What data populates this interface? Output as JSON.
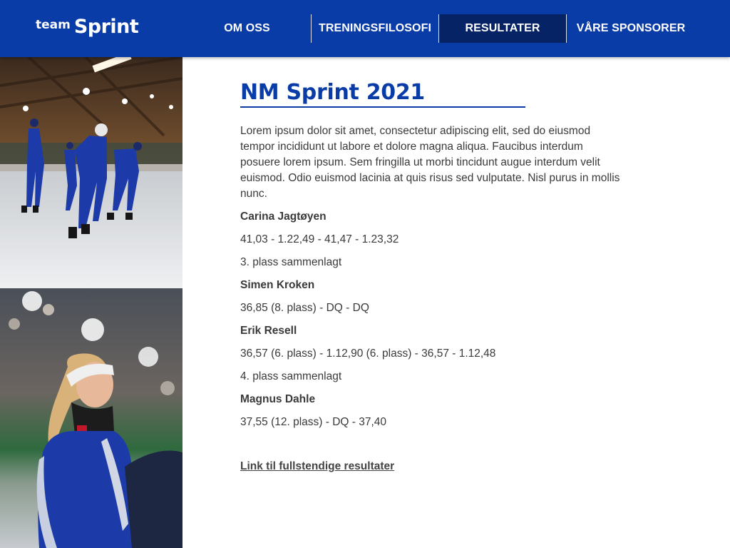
{
  "header": {
    "logo_small": "team",
    "logo_big": "Sprint",
    "nav": [
      {
        "label": "OM OSS"
      },
      {
        "label": "TRENINGSFILOSOFI"
      },
      {
        "label": "RESULTATER"
      },
      {
        "label": "VÅRE SPONSORER"
      }
    ],
    "active_nav": "RESULTATER"
  },
  "colors": {
    "brand_blue": "#0a3ca8",
    "active_nav_bg": "#062366"
  },
  "photos": [
    {
      "icon": "speed-skaters-photo"
    },
    {
      "icon": "skater-portrait-photo"
    }
  ],
  "main": {
    "title": "NM Sprint 2021",
    "intro": "Lorem ipsum dolor sit amet, consectetur adipiscing elit, sed do eiusmod tempor incididunt ut labore et dolore magna aliqua. Faucibus interdum posuere lorem ipsum. Sem fringilla ut morbi tincidunt augue interdum velit euismod. Odio euismod lacinia at quis risus sed vulputate. Nisl purus in mollis nunc.",
    "results": [
      {
        "kind": "name",
        "text": "Carina Jagtøyen"
      },
      {
        "kind": "line",
        "text": "41,03 - 1.22,49 - 41,47 - 1.23,32"
      },
      {
        "kind": "line",
        "text": "3. plass sammenlagt"
      },
      {
        "kind": "name",
        "text": "Simen Kroken"
      },
      {
        "kind": "line",
        "text": "36,85 (8. plass) - DQ - DQ"
      },
      {
        "kind": "name",
        "text": "Erik Resell"
      },
      {
        "kind": "line",
        "text": "36,57 (6. plass) - 1.12,90 (6. plass) - 36,57 - 1.12,48"
      },
      {
        "kind": "line",
        "text": "4. plass sammenlagt"
      },
      {
        "kind": "name",
        "text": "Magnus Dahle"
      },
      {
        "kind": "line",
        "text": "37,55 (12. plass) - DQ - 37,40"
      }
    ],
    "link_label": "Link til fullstendige resultater"
  }
}
